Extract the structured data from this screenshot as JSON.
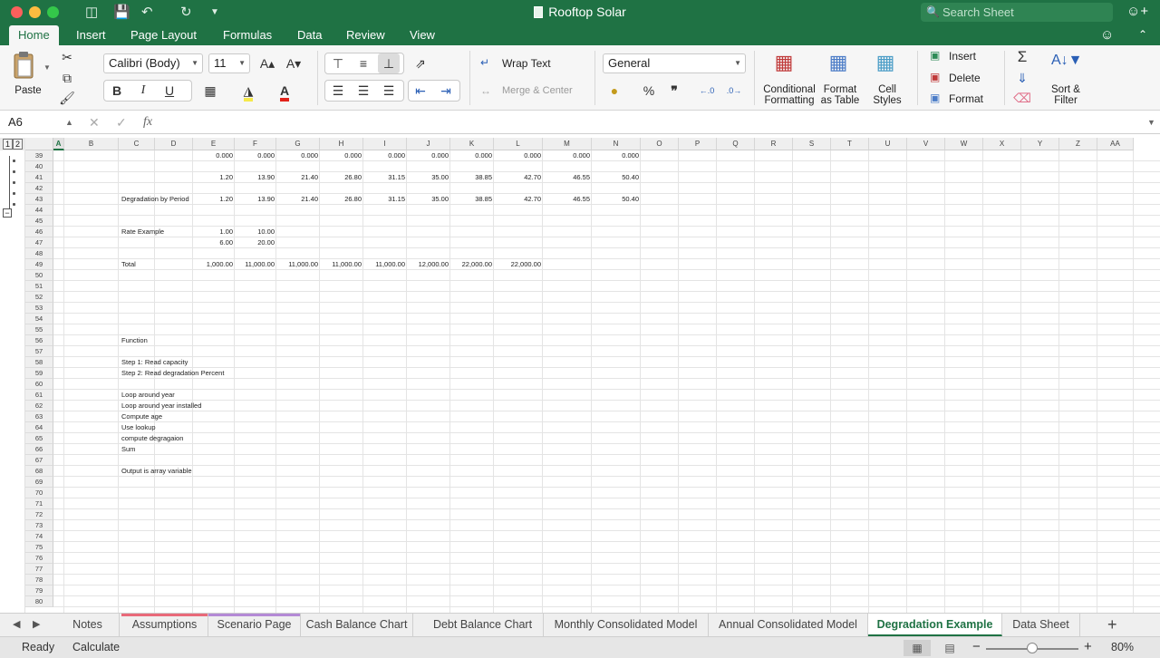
{
  "window": {
    "title": "Rooftop Solar",
    "search_placeholder": "Search Sheet"
  },
  "ribbon_tabs": [
    {
      "label": "Home",
      "active": true
    },
    {
      "label": "Insert"
    },
    {
      "label": "Page Layout"
    },
    {
      "label": "Formulas"
    },
    {
      "label": "Data"
    },
    {
      "label": "Review"
    },
    {
      "label": "View"
    }
  ],
  "home": {
    "paste": "Paste",
    "font_name": "Calibri (Body)",
    "font_size": "11",
    "bold": "B",
    "italic": "I",
    "underline": "U",
    "wrap_text": "Wrap Text",
    "merge_center": "Merge & Center",
    "number_format": "General",
    "percent": "%",
    "comma": "❞",
    "conditional_formatting": [
      "Conditional",
      "Formatting"
    ],
    "format_as_table": [
      "Format",
      "as Table"
    ],
    "cell_styles": [
      "Cell",
      "Styles"
    ],
    "insert": "Insert",
    "delete": "Delete",
    "format": "Format",
    "sort_filter": [
      "Sort &",
      "Filter"
    ]
  },
  "formula_bar": {
    "name_box": "A6",
    "fx": "fx",
    "content": ""
  },
  "outline_levels": [
    "1",
    "2"
  ],
  "columns": [
    "A",
    "B",
    "C",
    "D",
    "E",
    "F",
    "G",
    "H",
    "I",
    "J",
    "K",
    "L",
    "M",
    "N",
    "O",
    "P",
    "Q",
    "R",
    "S",
    "T",
    "U",
    "V",
    "W",
    "X",
    "Y",
    "Z",
    "AA"
  ],
  "selected_column": "A",
  "rows": [
    "39",
    "40",
    "41",
    "42",
    "43",
    "44",
    "45",
    "46",
    "47",
    "48",
    "49",
    "50",
    "51",
    "52",
    "53",
    "54",
    "55",
    "56",
    "57",
    "58",
    "59",
    "60",
    "61",
    "62",
    "63",
    "64",
    "65",
    "66",
    "67",
    "68",
    "69",
    "70",
    "71",
    "72",
    "73",
    "74",
    "75",
    "76",
    "77",
    "78",
    "79",
    "80"
  ],
  "cells": [
    {
      "row": 0,
      "col": "E",
      "v": "0.000"
    },
    {
      "row": 0,
      "col": "F",
      "v": "0.000"
    },
    {
      "row": 0,
      "col": "G",
      "v": "0.000"
    },
    {
      "row": 0,
      "col": "H",
      "v": "0.000"
    },
    {
      "row": 0,
      "col": "I",
      "v": "0.000"
    },
    {
      "row": 0,
      "col": "J",
      "v": "0.000"
    },
    {
      "row": 0,
      "col": "K",
      "v": "0.000"
    },
    {
      "row": 0,
      "col": "L",
      "v": "0.000"
    },
    {
      "row": 0,
      "col": "M",
      "v": "0.000"
    },
    {
      "row": 0,
      "col": "N",
      "v": "0.000"
    },
    {
      "row": 2,
      "col": "E",
      "v": "1.20"
    },
    {
      "row": 2,
      "col": "F",
      "v": "13.90"
    },
    {
      "row": 2,
      "col": "G",
      "v": "21.40"
    },
    {
      "row": 2,
      "col": "H",
      "v": "26.80"
    },
    {
      "row": 2,
      "col": "I",
      "v": "31.15"
    },
    {
      "row": 2,
      "col": "J",
      "v": "35.00"
    },
    {
      "row": 2,
      "col": "K",
      "v": "38.85"
    },
    {
      "row": 2,
      "col": "L",
      "v": "42.70"
    },
    {
      "row": 2,
      "col": "M",
      "v": "46.55"
    },
    {
      "row": 2,
      "col": "N",
      "v": "50.40"
    },
    {
      "row": 4,
      "col": "C",
      "v": "Degradation by Period",
      "t": true
    },
    {
      "row": 4,
      "col": "E",
      "v": "1.20"
    },
    {
      "row": 4,
      "col": "F",
      "v": "13.90"
    },
    {
      "row": 4,
      "col": "G",
      "v": "21.40"
    },
    {
      "row": 4,
      "col": "H",
      "v": "26.80"
    },
    {
      "row": 4,
      "col": "I",
      "v": "31.15"
    },
    {
      "row": 4,
      "col": "J",
      "v": "35.00"
    },
    {
      "row": 4,
      "col": "K",
      "v": "38.85"
    },
    {
      "row": 4,
      "col": "L",
      "v": "42.70"
    },
    {
      "row": 4,
      "col": "M",
      "v": "46.55"
    },
    {
      "row": 4,
      "col": "N",
      "v": "50.40"
    },
    {
      "row": 7,
      "col": "C",
      "v": "Rate Example",
      "t": true
    },
    {
      "row": 7,
      "col": "E",
      "v": "1.00"
    },
    {
      "row": 7,
      "col": "F",
      "v": "10.00"
    },
    {
      "row": 8,
      "col": "E",
      "v": "6.00"
    },
    {
      "row": 8,
      "col": "F",
      "v": "20.00"
    },
    {
      "row": 10,
      "col": "C",
      "v": "Total",
      "t": true
    },
    {
      "row": 10,
      "col": "E",
      "v": "1,000.00"
    },
    {
      "row": 10,
      "col": "F",
      "v": "11,000.00"
    },
    {
      "row": 10,
      "col": "G",
      "v": "11,000.00"
    },
    {
      "row": 10,
      "col": "H",
      "v": "11,000.00"
    },
    {
      "row": 10,
      "col": "I",
      "v": "11,000.00"
    },
    {
      "row": 10,
      "col": "J",
      "v": "12,000.00"
    },
    {
      "row": 10,
      "col": "K",
      "v": "22,000.00"
    },
    {
      "row": 10,
      "col": "L",
      "v": "22,000.00"
    },
    {
      "row": 17,
      "col": "C",
      "v": "Function",
      "t": true
    },
    {
      "row": 19,
      "col": "C",
      "v": "Step 1: Read capacity",
      "t": true
    },
    {
      "row": 20,
      "col": "C",
      "v": "Step 2: Read degradation Percent",
      "t": true
    },
    {
      "row": 22,
      "col": "C",
      "v": "Loop around year",
      "t": true
    },
    {
      "row": 23,
      "col": "C",
      "v": "Loop around year installed",
      "t": true
    },
    {
      "row": 24,
      "col": "C",
      "v": "Compute age",
      "t": true
    },
    {
      "row": 25,
      "col": "C",
      "v": "Use lookup",
      "t": true
    },
    {
      "row": 26,
      "col": "C",
      "v": "compute degragaion",
      "t": true
    },
    {
      "row": 27,
      "col": "C",
      "v": "Sum",
      "t": true
    },
    {
      "row": 29,
      "col": "C",
      "v": "Output is array variable",
      "t": true
    }
  ],
  "sheet_tabs": [
    {
      "label": "Notes"
    },
    {
      "label": "Assumptions",
      "color": "#e86a7a"
    },
    {
      "label": "Scenario Page",
      "color": "#b48ad6"
    },
    {
      "label": "Cash Balance Chart"
    },
    {
      "label": "Debt Balance Chart"
    },
    {
      "label": "Monthly Consolidated Model"
    },
    {
      "label": "Annual Consolidated Model"
    },
    {
      "label": "Degradation Example",
      "active": true
    },
    {
      "label": "Data Sheet"
    }
  ],
  "status": {
    "ready": "Ready",
    "calculate": "Calculate",
    "zoom": "80%",
    "zoom_value": 0.5
  }
}
